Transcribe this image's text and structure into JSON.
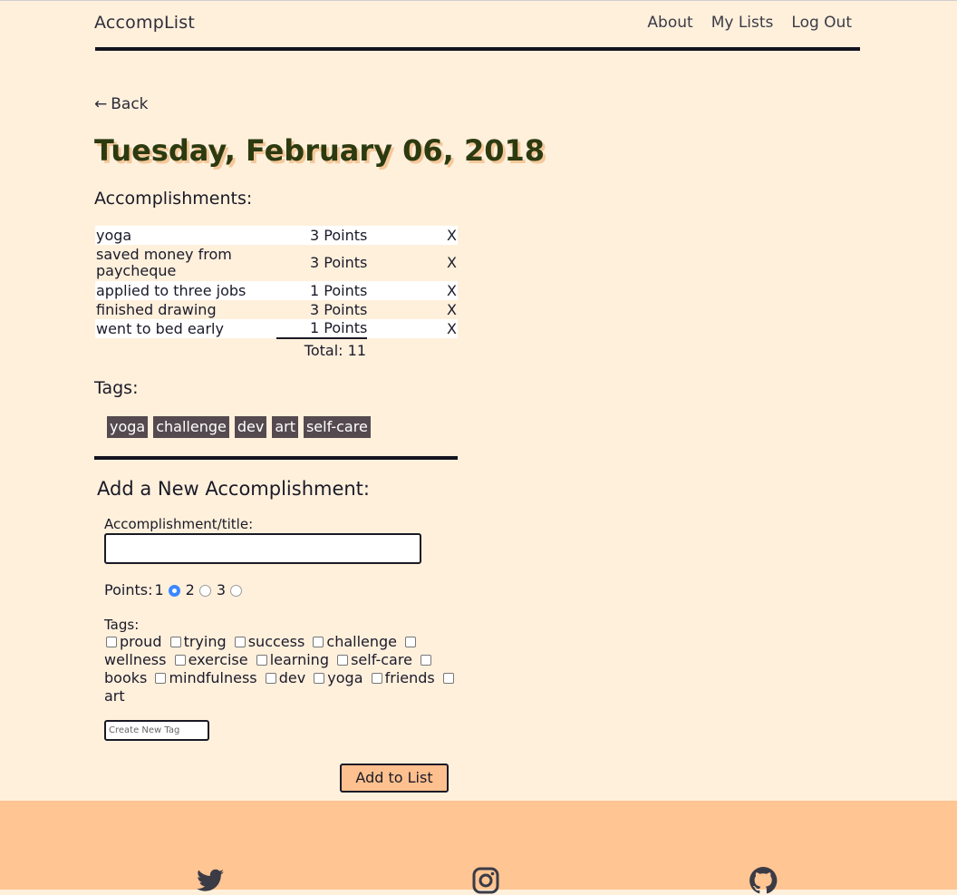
{
  "header": {
    "brand": "AccompList",
    "nav": [
      "About",
      "My Lists",
      "Log Out"
    ]
  },
  "back_label": "Back",
  "date_title": "Tuesday, February 06, 2018",
  "accomplishments": {
    "heading": "Accomplishments:",
    "rows": [
      {
        "name": "yoga",
        "points": "3 Points",
        "delete": "X"
      },
      {
        "name": "saved money from paycheque",
        "points": "3 Points",
        "delete": "X"
      },
      {
        "name": "applied to three jobs",
        "points": "1 Points",
        "delete": "X"
      },
      {
        "name": "finished drawing",
        "points": "3 Points",
        "delete": "X"
      },
      {
        "name": "went to bed early",
        "points": "1 Points",
        "delete": "X"
      }
    ],
    "total": "Total: 11"
  },
  "tags": {
    "heading": "Tags:",
    "items": [
      "yoga",
      "challenge",
      "dev",
      "art",
      "self-care"
    ]
  },
  "form": {
    "heading": "Add a New Accomplishment:",
    "title_label": "Accomplishment/title:",
    "title_value": "",
    "points_label": "Points:",
    "points_options": [
      "1",
      "2",
      "3"
    ],
    "points_selected": "1",
    "tags_label": "Tags:",
    "tag_options": [
      "proud",
      "trying",
      "success",
      "challenge",
      "wellness",
      "exercise",
      "learning",
      "self-care",
      "books",
      "mindfulness",
      "dev",
      "yoga",
      "friends",
      "art"
    ],
    "new_tag_placeholder": "Create New Tag",
    "submit_label": "Add to List"
  },
  "footer": {
    "icons": [
      "twitter-icon",
      "instagram-icon",
      "github-icon"
    ]
  },
  "colors": {
    "background": "#fff0dc",
    "footer": "#ffc593",
    "title_text": "#2c3a10",
    "title_shadow": "#f4c89a",
    "tag_bg": "#554a4f",
    "button_bg": "#ffc08f",
    "radio_selected": "#3a88ff"
  }
}
